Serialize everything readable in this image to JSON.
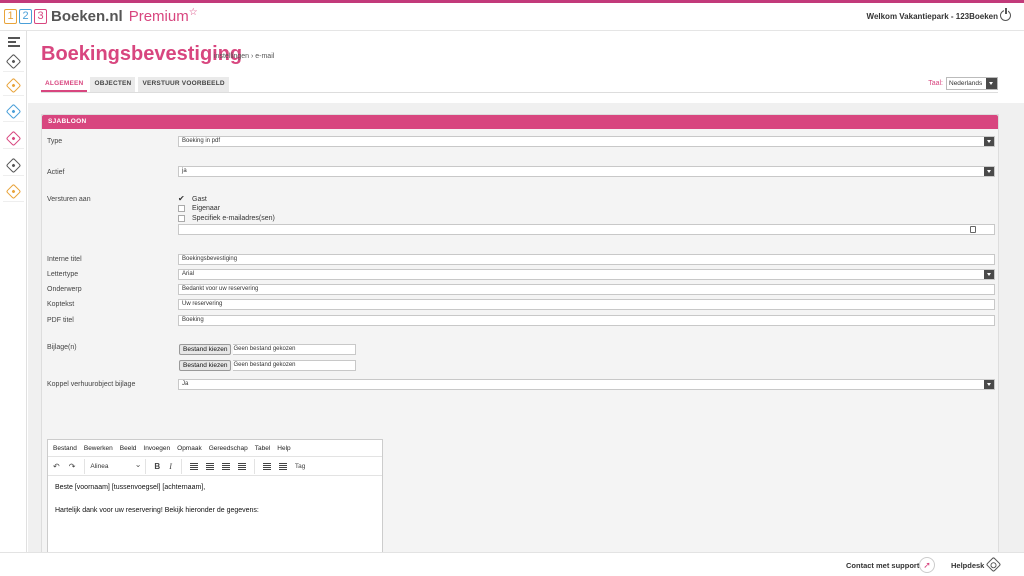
{
  "header": {
    "logo_numbers": [
      "1",
      "2",
      "3"
    ],
    "brand": "Boeken.nl",
    "premium": "Premium",
    "premium_star": "☆",
    "welcome": "Welkom Vakantiepark - 123Boeken"
  },
  "page": {
    "title": "Boekingsbevestiging",
    "breadcrumb": "instellingen › e-mail",
    "tabs": [
      {
        "label": "ALGEMEEN",
        "active": true
      },
      {
        "label": "OBJECTEN",
        "active": false
      },
      {
        "label": "VERSTUUR VOORBEELD",
        "active": false
      }
    ],
    "language_label": "Taal:",
    "language_value": "Nederlands"
  },
  "panel": {
    "title": "SJABLOON",
    "type_label": "Type",
    "type_value": "Boeking in pdf",
    "actief_label": "Actief",
    "actief_value": "ja",
    "versturen_label": "Versturen aan",
    "recipients": [
      {
        "label": "Gast",
        "checked": true
      },
      {
        "label": "Eigenaar",
        "checked": false
      },
      {
        "label": "Specifiek e-mailadres(sen)",
        "checked": false
      }
    ],
    "email_value": "",
    "interne_titel_label": "Interne titel",
    "interne_titel_value": "Boekingsbevestiging",
    "lettertype_label": "Lettertype",
    "lettertype_value": "Arial",
    "onderwerp_label": "Onderwerp",
    "onderwerp_value": "Bedankt voor uw reservering",
    "koptekst_label": "Koptekst",
    "koptekst_value": "Uw reservering",
    "pdf_titel_label": "PDF titel",
    "pdf_titel_value": "Boeking",
    "bijlage_label": "Bijlage(n)",
    "file_button": "Bestand kiezen",
    "file_none": "Geen bestand gekozen",
    "koppel_label": "Koppel verhuurobject bijlage",
    "koppel_value": "Ja"
  },
  "editor": {
    "menu": [
      "Bestand",
      "Bewerken",
      "Beeld",
      "Invoegen",
      "Opmaak",
      "Gereedschap",
      "Tabel",
      "Help"
    ],
    "format": "Alinea",
    "tag_label": "Tag",
    "undo": "↶",
    "redo": "↷",
    "bold": "B",
    "italic": "I",
    "body_line1": "Beste [voornaam] [tussenvoegsel] [achternaam],",
    "body_line2": "Hartelijk dank voor uw reservering! Bekijk hieronder de gegevens:"
  },
  "footer": {
    "support": "Contact met support",
    "help": "Helpdesk"
  },
  "colors": {
    "accent": "#d8467f",
    "topline": "#c23a7a"
  },
  "sidebar_icons": [
    "menu-icon",
    "dashboard-icon",
    "booking-icon",
    "objects-icon",
    "pricing-icon",
    "tickets-icon",
    "settings-icon"
  ]
}
